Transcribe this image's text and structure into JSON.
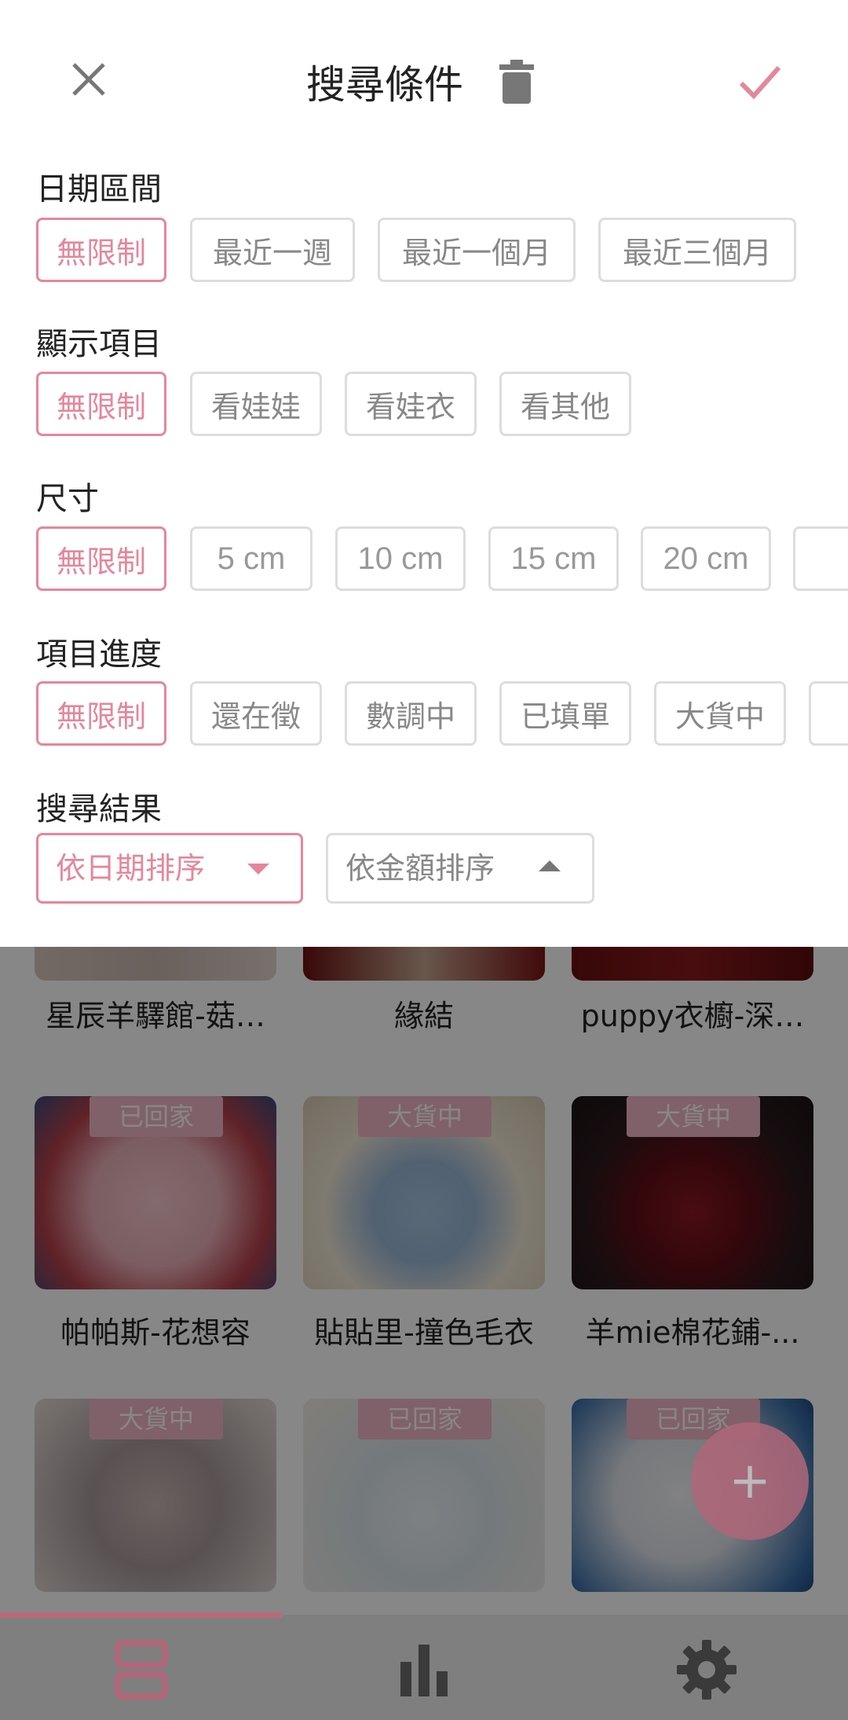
{
  "header": {
    "title": "搜尋條件",
    "close_icon": "close-icon",
    "trash_icon": "trash-icon",
    "confirm_icon": "check-icon",
    "accent_color": "#e4879b"
  },
  "filters": {
    "date": {
      "label": "日期區間",
      "options": [
        "無限制",
        "最近一週",
        "最近一個月",
        "最近三個月"
      ],
      "selected": "無限制"
    },
    "display": {
      "label": "顯示項目",
      "options": [
        "無限制",
        "看娃娃",
        "看娃衣",
        "看其他"
      ],
      "selected": "無限制"
    },
    "size": {
      "label": "尺寸",
      "options": [
        "無限制",
        "5 cm",
        "10 cm",
        "15 cm",
        "20 cm"
      ],
      "selected": "無限制"
    },
    "progress": {
      "label": "項目進度",
      "options": [
        "無限制",
        "還在徵",
        "數調中",
        "已填單",
        "大貨中"
      ],
      "selected": "無限制"
    },
    "sort": {
      "label": "搜尋結果",
      "by_date": "依日期排序",
      "by_amount": "依金額排序",
      "selected": "依日期排序"
    }
  },
  "grid": {
    "items": [
      {
        "title": "星辰羊驛館-菇…",
        "badge": ""
      },
      {
        "title": "緣結",
        "badge": ""
      },
      {
        "title": "puppy衣櫥-深…",
        "badge": ""
      },
      {
        "title": "帕帕斯-花想容",
        "badge": "已回家"
      },
      {
        "title": "貼貼里-撞色毛衣",
        "badge": "大貨中"
      },
      {
        "title": "羊mie棉花鋪-...",
        "badge": "大貨中"
      },
      {
        "title": "",
        "badge": "大貨中"
      },
      {
        "title": "",
        "badge": "已回家"
      },
      {
        "title": "",
        "badge": "已回家"
      }
    ]
  },
  "fab": {
    "label": "+"
  },
  "bottom_nav": {
    "items": [
      "list-icon",
      "bar-chart-icon",
      "gear-icon"
    ],
    "active": "list-icon"
  }
}
